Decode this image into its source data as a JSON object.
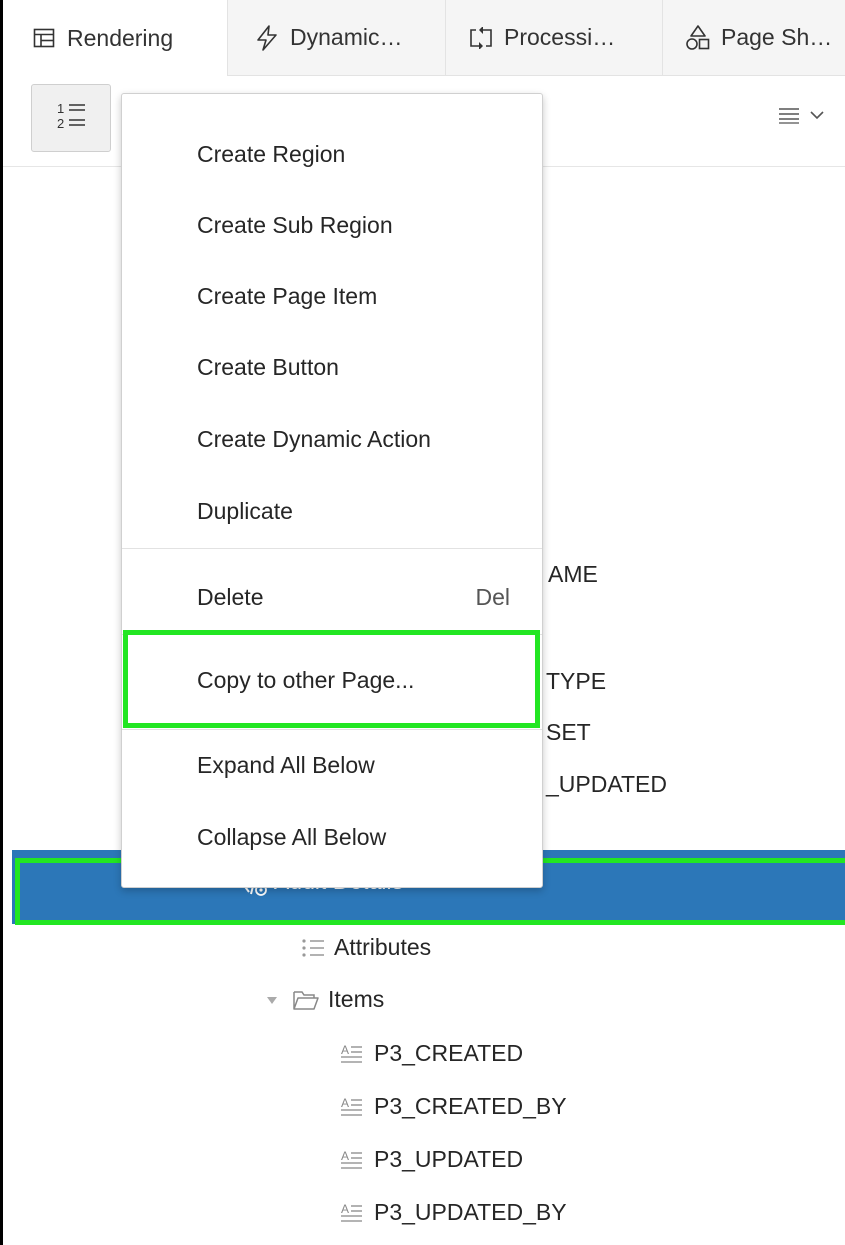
{
  "tabs": [
    {
      "label": "Rendering",
      "icon": "rendering-grid-icon",
      "active": true
    },
    {
      "label": "Dynamic…",
      "icon": "lightning-bolt-icon",
      "active": false
    },
    {
      "label": "Processi…",
      "icon": "processing-arrows-icon",
      "active": false
    },
    {
      "label": "Page Sh…",
      "icon": "shapes-icon",
      "active": false
    }
  ],
  "toolbar": {
    "order_icon": "ordered-list-icon",
    "menu_icon": "hamburger-menu-icon"
  },
  "context_menu": {
    "items": [
      {
        "label": "Create Region"
      },
      {
        "label": "Create Sub Region"
      },
      {
        "label": "Create Page Item"
      },
      {
        "label": "Create Button"
      },
      {
        "label": "Create Dynamic Action"
      },
      {
        "label": "Duplicate"
      },
      {
        "label": "Delete",
        "shortcut": "Del"
      },
      {
        "label": "Copy to other Page..."
      },
      {
        "label": "Expand All Below"
      },
      {
        "label": "Collapse All Below"
      }
    ]
  },
  "tree": {
    "partial_labels": [
      "AME",
      "TYPE",
      "SET",
      "_UPDATED"
    ],
    "selected_row": {
      "label": "Audit Details"
    },
    "attributes_label": "Attributes",
    "items_label": "Items",
    "page_items": [
      "P3_CREATED",
      "P3_CREATED_BY",
      "P3_UPDATED",
      "P3_UPDATED_BY"
    ]
  },
  "colors": {
    "selection": "#2c77b8",
    "highlight": "#22e622"
  }
}
